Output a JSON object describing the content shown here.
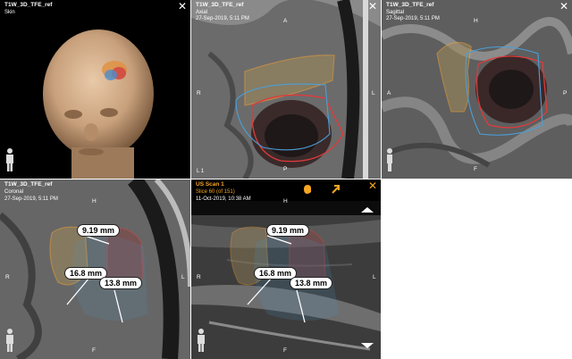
{
  "panels": {
    "skin": {
      "series": "T1W_3D_TFE_ref",
      "view": "Skin",
      "close": "✕"
    },
    "axial": {
      "series": "T1W_3D_TFE_ref",
      "view": "Axial",
      "date": "27-Sep-2019, 5:11 PM",
      "close": "✕",
      "orient": {
        "top": "A",
        "left": "R",
        "right": "L",
        "bottom": "P"
      },
      "indicator": "L  1"
    },
    "sagittal": {
      "series": "T1W_3D_TFE_ref",
      "view": "Sagittal",
      "date": "27-Sep-2019, 5:11 PM",
      "close": "✕",
      "orient": {
        "top": "H",
        "left": "A",
        "right": "P",
        "bottom": "F"
      }
    },
    "coronal": {
      "series": "T1W_3D_TFE_ref",
      "view": "Coronal",
      "date": "27-Sep-2019, 5:11 PM",
      "orient": {
        "top": "H",
        "left": "R",
        "right": "L",
        "bottom": "F"
      },
      "measurements": [
        "9.19 mm",
        "16.8 mm",
        "13.8 mm"
      ]
    },
    "us": {
      "series": "US Scan 1",
      "slice": "Slice 60 (of 151)",
      "date": "11-Oct-2019, 10:38 AM",
      "close": "✕",
      "orient": {
        "top": "H",
        "left": "R",
        "right": "L",
        "bottom": "F"
      },
      "measurements": [
        "9.19 mm",
        "16.8 mm",
        "13.8 mm"
      ]
    }
  },
  "colors": {
    "accent": "#f5a623",
    "outline_orange": "#e8a13a",
    "outline_red": "#e03a3a",
    "outline_blue": "#4a9fd8"
  },
  "icons": [
    "close-icon",
    "hand-icon",
    "arrow-icon",
    "person-orientation-icon",
    "scroll-up-icon",
    "scroll-down-icon"
  ]
}
